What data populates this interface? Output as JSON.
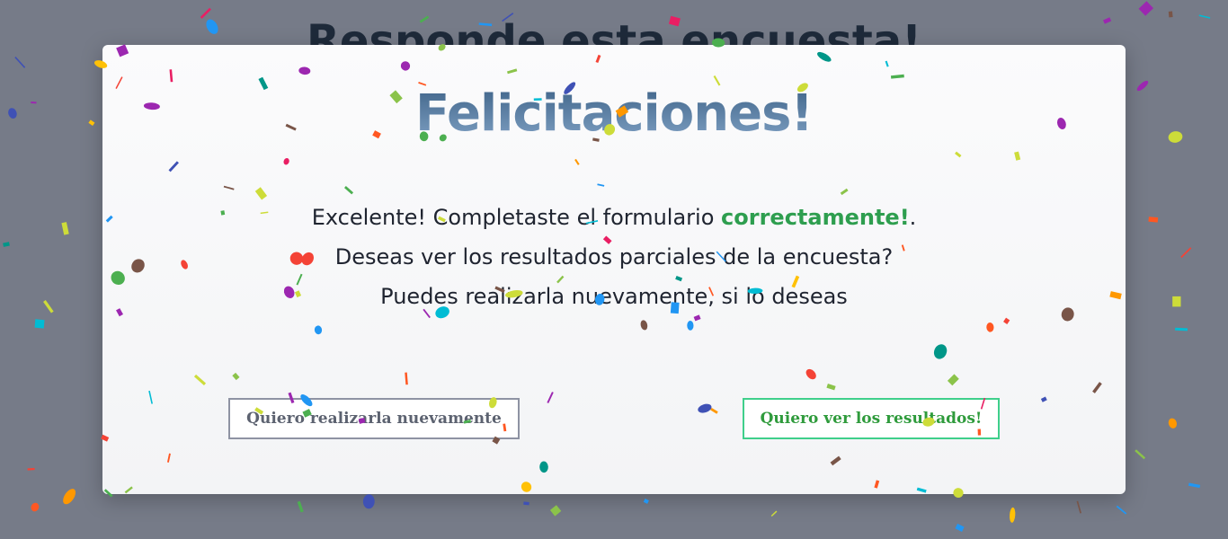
{
  "background": {
    "title": "Responde esta encuesta!"
  },
  "modal": {
    "title": "Felicitaciones!",
    "line1_prefix": "Excelente! Completaste el formulario ",
    "line1_accent": "correctamente!",
    "line1_suffix": ".",
    "line2": "Deseas ver los resultados parciales de la encuesta?",
    "line3": "Puedes realizarla nuevamente, si lo deseas",
    "accent_color": "#2e9e4f"
  },
  "buttons": {
    "again_label": "Quiero realizarla nuevamente",
    "results_label": "Quiero ver los resultados!"
  },
  "confetti": {
    "colors": [
      "#f44336",
      "#2196f3",
      "#ffc107",
      "#4caf50",
      "#9c27b0",
      "#795548",
      "#00bcd4",
      "#ff5722",
      "#3f51b5",
      "#cddc39",
      "#009688",
      "#e91e63",
      "#8bc34a",
      "#ff9800"
    ]
  }
}
